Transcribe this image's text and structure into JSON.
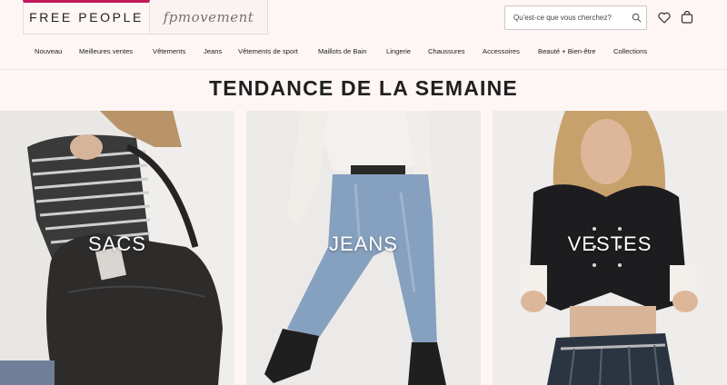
{
  "header": {
    "brand_free_people": "FREE PEOPLE",
    "brand_fp_movement": "fpmovement",
    "search": {
      "placeholder": "Qu'est-ce que vous cherchez?"
    },
    "icons": {
      "search": "search-icon",
      "wishlist": "heart-icon",
      "bag": "shopping-bag-icon"
    }
  },
  "nav": {
    "items": [
      "Nouveau",
      "Meilleures ventes",
      "Vêtements",
      "Jeans",
      "Vêtements de sport",
      "Maillots de Bain",
      "Lingerie",
      "Chaussures",
      "Accessoires",
      "Beauté + Bien-être",
      "Collections"
    ]
  },
  "section": {
    "title": "TENDANCE DE LA SEMAINE"
  },
  "cards": [
    {
      "label": "SACS"
    },
    {
      "label": "JEANS"
    },
    {
      "label": "VESTES"
    }
  ],
  "colors": {
    "background": "#fdf6f4",
    "accent": "#c2185b",
    "text": "#222222"
  }
}
